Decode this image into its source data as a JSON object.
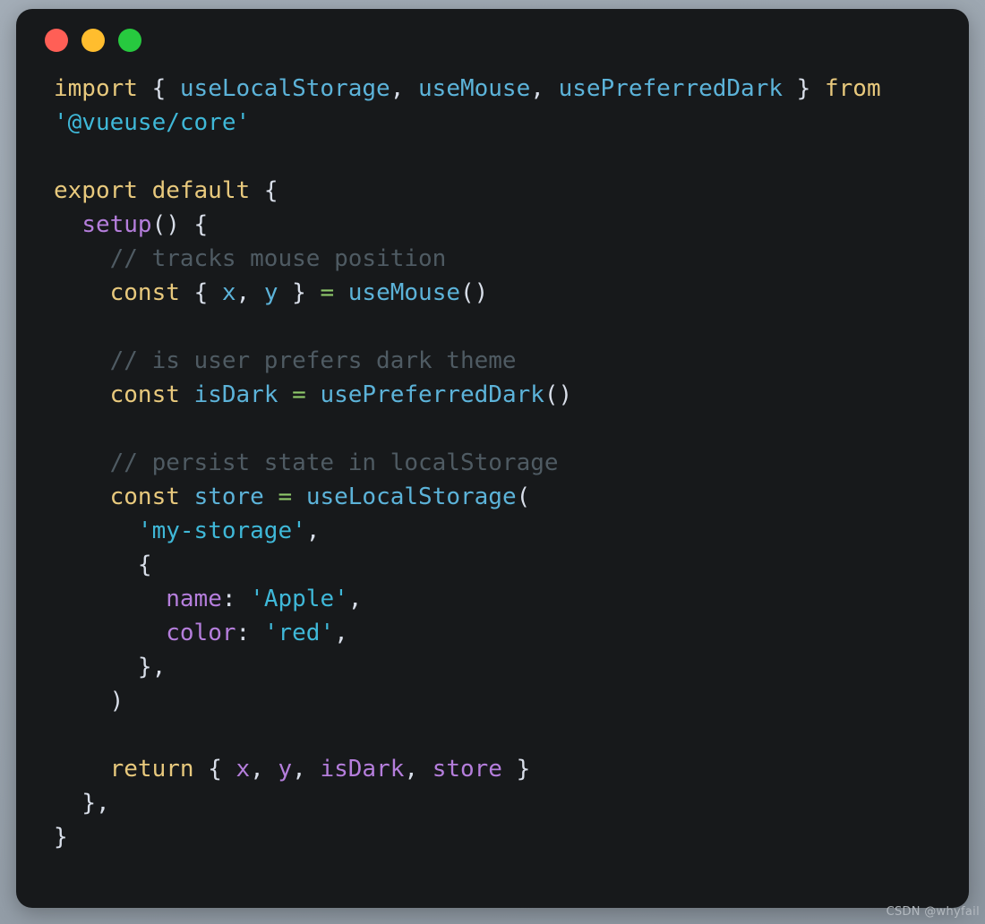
{
  "window": {
    "controls": [
      {
        "name": "close",
        "color": "#ff5f56"
      },
      {
        "name": "minimize",
        "color": "#ffbd2e"
      },
      {
        "name": "maximize",
        "color": "#27c93f"
      }
    ]
  },
  "theme": {
    "page_background": "#a0aab4",
    "editor_background": "#17191b",
    "keyword": "#e8c97d",
    "identifier": "#5cb3d9",
    "string": "#3fb8d8",
    "function": "#b57edc",
    "property": "#b57edc",
    "operator": "#8fc96a",
    "punctuation": "#d8dee9",
    "comment": "#4f5b63"
  },
  "code": {
    "language": "javascript",
    "raw": "import { useLocalStorage, useMouse, usePreferredDark } from '@vueuse/core'\n\nexport default {\n  setup() {\n    // tracks mouse position\n    const { x, y } = useMouse()\n\n    // is user prefers dark theme\n    const isDark = usePreferredDark()\n\n    // persist state in localStorage\n    const store = useLocalStorage(\n      'my-storage',\n      {\n        name: 'Apple',\n        color: 'red',\n      },\n    )\n\n    return { x, y, isDark, store }\n  },\n}",
    "lines": [
      {
        "tokens": [
          {
            "t": "import",
            "c": "keyword"
          },
          {
            "t": " ",
            "c": "plain"
          },
          {
            "t": "{",
            "c": "punct"
          },
          {
            "t": " ",
            "c": "plain"
          },
          {
            "t": "useLocalStorage",
            "c": "ident"
          },
          {
            "t": ",",
            "c": "punct"
          },
          {
            "t": " ",
            "c": "plain"
          },
          {
            "t": "useMouse",
            "c": "ident"
          },
          {
            "t": ",",
            "c": "punct"
          },
          {
            "t": " ",
            "c": "plain"
          },
          {
            "t": "usePreferredDark",
            "c": "ident"
          },
          {
            "t": " ",
            "c": "plain"
          },
          {
            "t": "}",
            "c": "punct"
          },
          {
            "t": " ",
            "c": "plain"
          },
          {
            "t": "from",
            "c": "keyword"
          }
        ]
      },
      {
        "tokens": [
          {
            "t": "'@vueuse/core'",
            "c": "string"
          }
        ]
      },
      {
        "tokens": []
      },
      {
        "tokens": [
          {
            "t": "export default",
            "c": "keyword"
          },
          {
            "t": " ",
            "c": "plain"
          },
          {
            "t": "{",
            "c": "punct"
          }
        ]
      },
      {
        "tokens": [
          {
            "t": "  ",
            "c": "plain"
          },
          {
            "t": "setup",
            "c": "func"
          },
          {
            "t": "() {",
            "c": "punct"
          }
        ]
      },
      {
        "tokens": [
          {
            "t": "    ",
            "c": "plain"
          },
          {
            "t": "// tracks mouse position",
            "c": "comment"
          }
        ]
      },
      {
        "tokens": [
          {
            "t": "    ",
            "c": "plain"
          },
          {
            "t": "const",
            "c": "keyword"
          },
          {
            "t": " ",
            "c": "plain"
          },
          {
            "t": "{",
            "c": "punct"
          },
          {
            "t": " ",
            "c": "plain"
          },
          {
            "t": "x",
            "c": "ident"
          },
          {
            "t": ",",
            "c": "punct"
          },
          {
            "t": " ",
            "c": "plain"
          },
          {
            "t": "y",
            "c": "ident"
          },
          {
            "t": " ",
            "c": "plain"
          },
          {
            "t": "}",
            "c": "punct"
          },
          {
            "t": " ",
            "c": "plain"
          },
          {
            "t": "=",
            "c": "op"
          },
          {
            "t": " ",
            "c": "plain"
          },
          {
            "t": "useMouse",
            "c": "ident"
          },
          {
            "t": "()",
            "c": "punct"
          }
        ]
      },
      {
        "tokens": []
      },
      {
        "tokens": [
          {
            "t": "    ",
            "c": "plain"
          },
          {
            "t": "// is user prefers dark theme",
            "c": "comment"
          }
        ]
      },
      {
        "tokens": [
          {
            "t": "    ",
            "c": "plain"
          },
          {
            "t": "const",
            "c": "keyword"
          },
          {
            "t": " ",
            "c": "plain"
          },
          {
            "t": "isDark",
            "c": "ident"
          },
          {
            "t": " ",
            "c": "plain"
          },
          {
            "t": "=",
            "c": "op"
          },
          {
            "t": " ",
            "c": "plain"
          },
          {
            "t": "usePreferredDark",
            "c": "ident"
          },
          {
            "t": "()",
            "c": "punct"
          }
        ]
      },
      {
        "tokens": []
      },
      {
        "tokens": [
          {
            "t": "    ",
            "c": "plain"
          },
          {
            "t": "// persist state in localStorage",
            "c": "comment"
          }
        ]
      },
      {
        "tokens": [
          {
            "t": "    ",
            "c": "plain"
          },
          {
            "t": "const",
            "c": "keyword"
          },
          {
            "t": " ",
            "c": "plain"
          },
          {
            "t": "store",
            "c": "ident"
          },
          {
            "t": " ",
            "c": "plain"
          },
          {
            "t": "=",
            "c": "op"
          },
          {
            "t": " ",
            "c": "plain"
          },
          {
            "t": "useLocalStorage",
            "c": "ident"
          },
          {
            "t": "(",
            "c": "punct"
          }
        ]
      },
      {
        "tokens": [
          {
            "t": "      ",
            "c": "plain"
          },
          {
            "t": "'my-storage'",
            "c": "string"
          },
          {
            "t": ",",
            "c": "punct"
          }
        ]
      },
      {
        "tokens": [
          {
            "t": "      ",
            "c": "plain"
          },
          {
            "t": "{",
            "c": "punct"
          }
        ]
      },
      {
        "tokens": [
          {
            "t": "        ",
            "c": "plain"
          },
          {
            "t": "name",
            "c": "prop"
          },
          {
            "t": ": ",
            "c": "punct"
          },
          {
            "t": "'Apple'",
            "c": "string"
          },
          {
            "t": ",",
            "c": "punct"
          }
        ]
      },
      {
        "tokens": [
          {
            "t": "        ",
            "c": "plain"
          },
          {
            "t": "color",
            "c": "prop"
          },
          {
            "t": ": ",
            "c": "punct"
          },
          {
            "t": "'red'",
            "c": "string"
          },
          {
            "t": ",",
            "c": "punct"
          }
        ]
      },
      {
        "tokens": [
          {
            "t": "      ",
            "c": "plain"
          },
          {
            "t": "},",
            "c": "punct"
          }
        ]
      },
      {
        "tokens": [
          {
            "t": "    ",
            "c": "plain"
          },
          {
            "t": ")",
            "c": "punct"
          }
        ]
      },
      {
        "tokens": []
      },
      {
        "tokens": [
          {
            "t": "    ",
            "c": "plain"
          },
          {
            "t": "return",
            "c": "keyword"
          },
          {
            "t": " ",
            "c": "plain"
          },
          {
            "t": "{",
            "c": "punct"
          },
          {
            "t": " ",
            "c": "plain"
          },
          {
            "t": "x",
            "c": "prop"
          },
          {
            "t": ",",
            "c": "punct"
          },
          {
            "t": " ",
            "c": "plain"
          },
          {
            "t": "y",
            "c": "prop"
          },
          {
            "t": ",",
            "c": "punct"
          },
          {
            "t": " ",
            "c": "plain"
          },
          {
            "t": "isDark",
            "c": "prop"
          },
          {
            "t": ",",
            "c": "punct"
          },
          {
            "t": " ",
            "c": "plain"
          },
          {
            "t": "store",
            "c": "prop"
          },
          {
            "t": " ",
            "c": "plain"
          },
          {
            "t": "}",
            "c": "punct"
          }
        ]
      },
      {
        "tokens": [
          {
            "t": "  ",
            "c": "plain"
          },
          {
            "t": "},",
            "c": "punct"
          }
        ]
      },
      {
        "tokens": [
          {
            "t": "}",
            "c": "punct"
          }
        ]
      }
    ]
  },
  "watermark": {
    "text": "CSDN @whyfail"
  }
}
